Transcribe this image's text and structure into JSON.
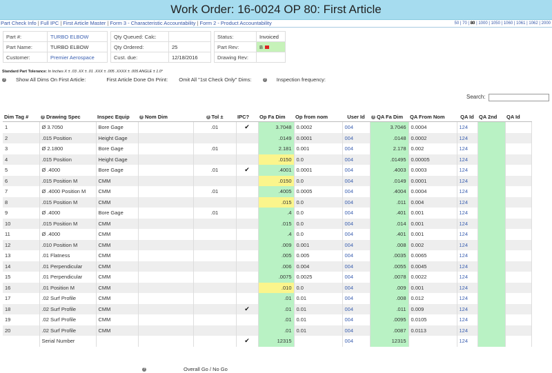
{
  "title": "Work Order: 16-0024 OP 80: First Article",
  "nav": {
    "links": [
      "Part Check Info",
      "Full IPC",
      "First Article Master",
      "Form 3 - Characteristic Accountability",
      "Form 2 - Product Accountability"
    ],
    "right_ops": [
      "50",
      "70",
      "80",
      "1000",
      "1050",
      "1060",
      "1061",
      "1062",
      "2000"
    ],
    "active_op": "80"
  },
  "info": {
    "part_no_label": "Part #:",
    "part_no": "TURBO ELBOW",
    "part_name_label": "Part Name:",
    "part_name": "TURBO ELBOW",
    "customer_label": "Customer:",
    "customer": "Premier Aerospace",
    "qty_queued_label": "Qty Queued: Calc:",
    "qty_queued": "",
    "qty_ordered_label": "Qty Ordered:",
    "qty_ordered": "25",
    "cust_due_label": "Cust. due:",
    "cust_due": "12/18/2016",
    "status_label": "Status:",
    "status": "Invoiced",
    "part_rev_label": "Part Rev:",
    "part_rev": "B",
    "drawing_rev_label": "Drawing Rev:",
    "drawing_rev": ""
  },
  "tolerance": {
    "label": "Standard Part Tolerance:",
    "text": "In Inches X ± .03   .XX ± .01   .XXX ± .005   .XXXX ± .005   ANGLE ± 1.0°"
  },
  "options": {
    "show_all": "Show All Dims On First Article:",
    "done_on_print": "First Article Done On Print:",
    "omit": "Omit All \"1st Check Only\" Dims:",
    "inspection": "Inspection frequency:"
  },
  "search": {
    "label": "Search:",
    "value": ""
  },
  "columns": {
    "dim_tag": "Dim Tag #",
    "drawing_spec": "Drawing Spec",
    "inspec_equip": "Inspec Equip",
    "nom_dim": "Nom Dim",
    "tol": "Tol ±",
    "ipc": "IPC?",
    "op_fa_dim": "Op Fa Dim",
    "op_from_nom": "Op from nom",
    "user_id": "User Id",
    "qa_fa_dim": "QA Fa Dim",
    "qa_from_nom": "QA From Nom",
    "qa_id": "QA Id",
    "qa_2nd": "QA 2nd",
    "qa_id2": "QA Id"
  },
  "rows": [
    {
      "tag": "1",
      "spec": "Ø 3.7050",
      "equip": "Bore Gage",
      "nom": "",
      "tol": ".01",
      "ipc": "✔",
      "op": "3.7048",
      "opn": "0.0002",
      "user": "004",
      "qa": "3.7046",
      "qan": "0.0004",
      "qaid": "124",
      "yellow": false
    },
    {
      "tag": "2",
      "spec": ".015 Position",
      "equip": "Height Gage",
      "nom": "",
      "tol": "",
      "ipc": "",
      "op": ".0149",
      "opn": "0.0001",
      "user": "004",
      "qa": ".0148",
      "qan": "0.0002",
      "qaid": "124",
      "yellow": false
    },
    {
      "tag": "3",
      "spec": "Ø 2.1800",
      "equip": "Bore Gage",
      "nom": "",
      "tol": ".01",
      "ipc": "",
      "op": "2.181",
      "opn": "0.001",
      "user": "004",
      "qa": "2.178",
      "qan": "0.002",
      "qaid": "124",
      "yellow": false
    },
    {
      "tag": "4",
      "spec": ".015 Position",
      "equip": "Height Gage",
      "nom": "",
      "tol": "",
      "ipc": "",
      "op": ".0150",
      "opn": "0.0",
      "user": "004",
      "qa": ".01495",
      "qan": "0.00005",
      "qaid": "124",
      "yellow": true
    },
    {
      "tag": "5",
      "spec": "Ø .4000",
      "equip": "Bore Gage",
      "nom": "",
      "tol": ".01",
      "ipc": "✔",
      "op": ".4001",
      "opn": "0.0001",
      "user": "004",
      "qa": ".4003",
      "qan": "0.0003",
      "qaid": "124",
      "yellow": false
    },
    {
      "tag": "6",
      "spec": ".015 Position M",
      "equip": "CMM",
      "nom": "",
      "tol": "",
      "ipc": "",
      "op": ".0150",
      "opn": "0.0",
      "user": "004",
      "qa": ".0149",
      "qan": "0.0001",
      "qaid": "124",
      "yellow": true
    },
    {
      "tag": "7",
      "spec": "Ø .4000 Position M",
      "equip": "CMM",
      "nom": "",
      "tol": ".01",
      "ipc": "",
      "op": ".4005",
      "opn": "0.0005",
      "user": "004",
      "qa": ".4004",
      "qan": "0.0004",
      "qaid": "124",
      "yellow": false
    },
    {
      "tag": "8",
      "spec": ".015 Position M",
      "equip": "CMM",
      "nom": "",
      "tol": "",
      "ipc": "",
      "op": ".015",
      "opn": "0.0",
      "user": "004",
      "qa": ".011",
      "qan": "0.004",
      "qaid": "124",
      "yellow": true
    },
    {
      "tag": "9",
      "spec": "Ø .4000",
      "equip": "Bore Gage",
      "nom": "",
      "tol": ".01",
      "ipc": "",
      "op": ".4",
      "opn": "0.0",
      "user": "004",
      "qa": ".401",
      "qan": "0.001",
      "qaid": "124",
      "yellow": false
    },
    {
      "tag": "10",
      "spec": ".015 Position M",
      "equip": "CMM",
      "nom": "",
      "tol": "",
      "ipc": "",
      "op": ".015",
      "opn": "0.0",
      "user": "004",
      "qa": ".014",
      "qan": "0.001",
      "qaid": "124",
      "yellow": false
    },
    {
      "tag": "11",
      "spec": "Ø .4000",
      "equip": "CMM",
      "nom": "",
      "tol": "",
      "ipc": "",
      "op": ".4",
      "opn": "0.0",
      "user": "004",
      "qa": ".401",
      "qan": "0.001",
      "qaid": "124",
      "yellow": false
    },
    {
      "tag": "12",
      "spec": ".010 Position M",
      "equip": "CMM",
      "nom": "",
      "tol": "",
      "ipc": "",
      "op": ".009",
      "opn": "0.001",
      "user": "004",
      "qa": ".008",
      "qan": "0.002",
      "qaid": "124",
      "yellow": false
    },
    {
      "tag": "13",
      "spec": ".01 Flatness",
      "equip": "CMM",
      "nom": "",
      "tol": "",
      "ipc": "",
      "op": ".005",
      "opn": "0.005",
      "user": "004",
      "qa": ".0035",
      "qan": "0.0065",
      "qaid": "124",
      "yellow": false
    },
    {
      "tag": "14",
      "spec": ".01 Perpendicular",
      "equip": "CMM",
      "nom": "",
      "tol": "",
      "ipc": "",
      "op": ".006",
      "opn": "0.004",
      "user": "004",
      "qa": ".0055",
      "qan": "0.0045",
      "qaid": "124",
      "yellow": false
    },
    {
      "tag": "15",
      "spec": ".01 Perpendicular",
      "equip": "CMM",
      "nom": "",
      "tol": "",
      "ipc": "",
      "op": ".0075",
      "opn": "0.0025",
      "user": "004",
      "qa": ".0078",
      "qan": "0.0022",
      "qaid": "124",
      "yellow": false
    },
    {
      "tag": "16",
      "spec": ".01 Position M",
      "equip": "CMM",
      "nom": "",
      "tol": "",
      "ipc": "",
      "op": ".010",
      "opn": "0.0",
      "user": "004",
      "qa": ".009",
      "qan": "0.001",
      "qaid": "124",
      "yellow": true
    },
    {
      "tag": "17",
      "spec": ".02 Surf Profile",
      "equip": "CMM",
      "nom": "",
      "tol": "",
      "ipc": "",
      "op": ".01",
      "opn": "0.01",
      "user": "004",
      "qa": ".008",
      "qan": "0.012",
      "qaid": "124",
      "yellow": false
    },
    {
      "tag": "18",
      "spec": ".02 Surf Profile",
      "equip": "CMM",
      "nom": "",
      "tol": "",
      "ipc": "✔",
      "op": ".01",
      "opn": "0.01",
      "user": "004",
      "qa": ".011",
      "qan": "0.009",
      "qaid": "124",
      "yellow": false
    },
    {
      "tag": "19",
      "spec": ".02 Surf Profile",
      "equip": "CMM",
      "nom": "",
      "tol": "",
      "ipc": "",
      "op": ".01",
      "opn": "0.01",
      "user": "004",
      "qa": ".0095",
      "qan": "0.0105",
      "qaid": "124",
      "yellow": false
    },
    {
      "tag": "20",
      "spec": ".02 Surf Profile",
      "equip": "CMM",
      "nom": "",
      "tol": "",
      "ipc": "",
      "op": ".01",
      "opn": "0.01",
      "user": "004",
      "qa": ".0087",
      "qan": "0.0113",
      "qaid": "124",
      "yellow": false
    },
    {
      "tag": "",
      "spec": "Serial Number",
      "equip": "",
      "nom": "",
      "tol": "",
      "ipc": "✔",
      "op": "12315",
      "opn": "",
      "user": "004",
      "qa": "12315",
      "qan": "",
      "qaid": "124",
      "yellow": false
    }
  ],
  "footer": {
    "go_nogo": "Overall Go / No Go"
  },
  "icons": {
    "help": "question-circle-icon",
    "check": "checkmark-icon",
    "flag": "flag-icon"
  },
  "colors": {
    "title_bg": "#a6dcef",
    "green_cell": "#b9f2c4",
    "yellow_cell": "#fbf58c",
    "link": "#3a5fb0",
    "flag": "#d22222"
  }
}
